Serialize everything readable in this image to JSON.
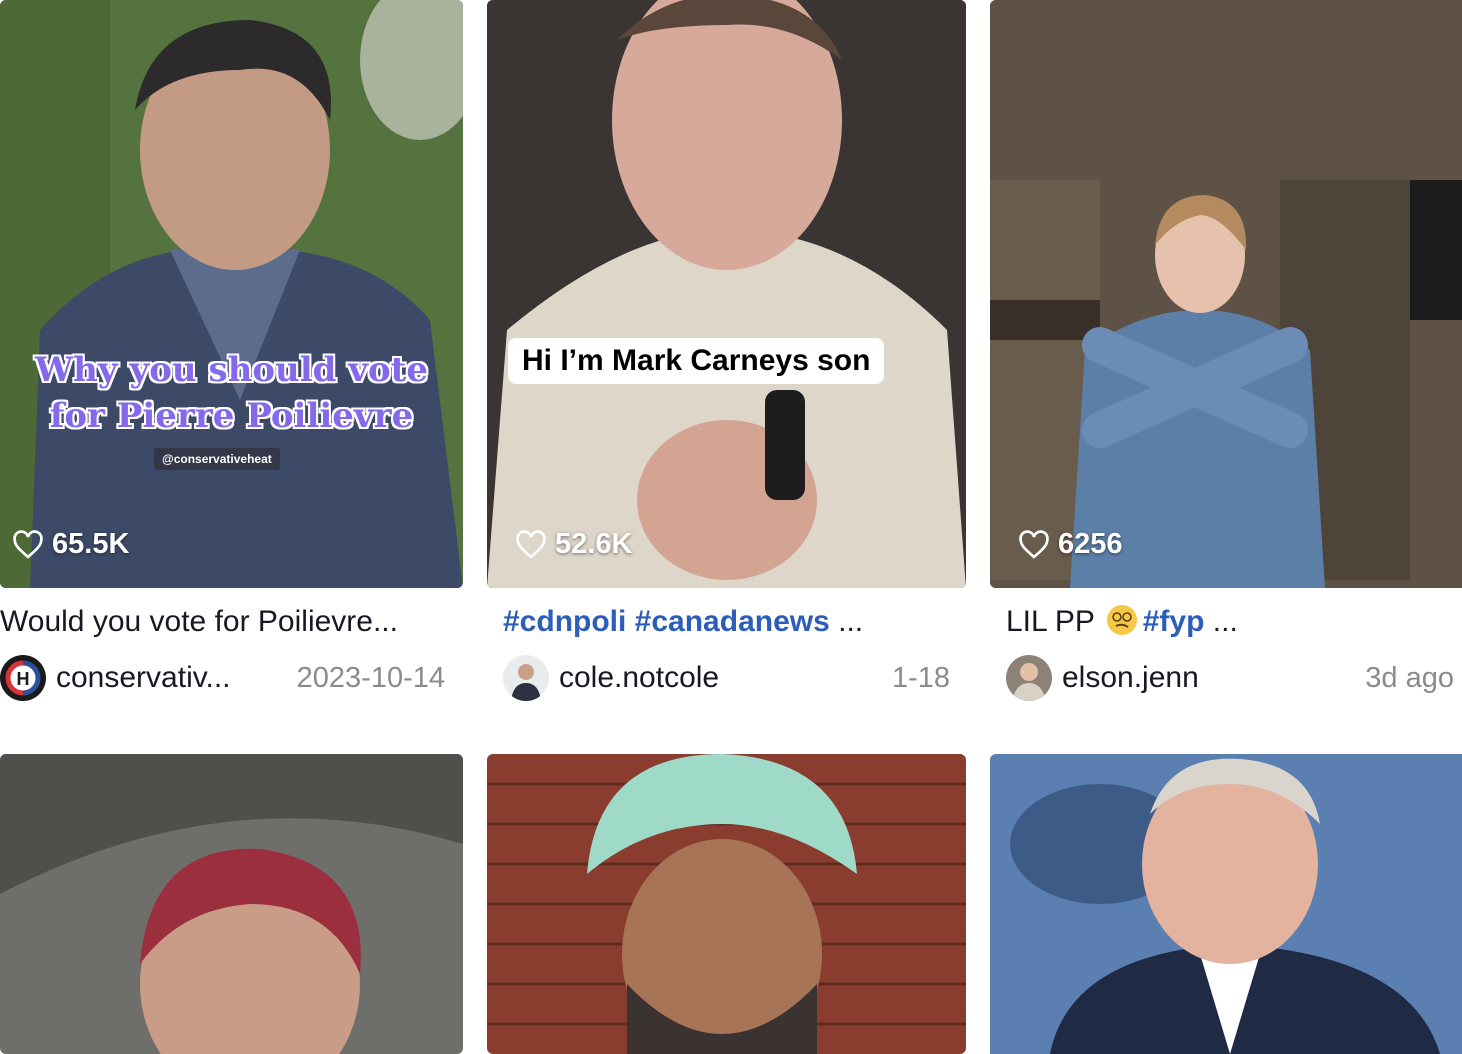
{
  "videos": [
    {
      "likes": "65.5K",
      "caption": "Would you vote for Poilievre...",
      "author": "conservativ...",
      "date": "2023-10-14",
      "overlay_line1": "Why you should vote",
      "overlay_line2": "for Pierre Poilievre",
      "watermark": "@conservativeheat"
    },
    {
      "likes": "52.6K",
      "caption_tags": "#cdnpoli #canadanews",
      "caption_more": " ...",
      "author": "cole.notcole",
      "date": "1-18",
      "sticker": "Hi I’m Mark Carneys son"
    },
    {
      "likes": "6256",
      "caption_text": "LIL PP ",
      "caption_tag": "#fyp",
      "caption_more": " ...",
      "author": "elson.jenn",
      "date": "3d ago"
    }
  ],
  "colors": {
    "hashtag": "#2b5db9",
    "muted": "#8a8b91",
    "overlay_purple": "#8469ea"
  }
}
